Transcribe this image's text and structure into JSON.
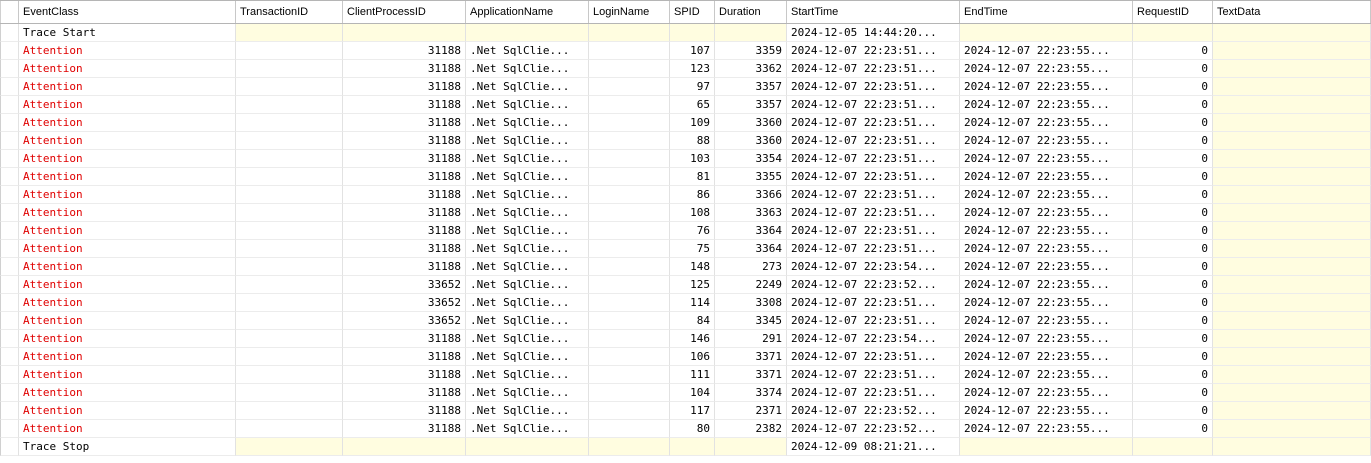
{
  "columns": [
    "EventClass",
    "TransactionID",
    "ClientProcessID",
    "ApplicationName",
    "LoginName",
    "SPID",
    "Duration",
    "StartTime",
    "EndTime",
    "RequestID",
    "TextData"
  ],
  "rows": [
    {
      "event": "Trace Start",
      "transaction": "",
      "client_pid": "",
      "app": "",
      "login": "",
      "spid": "",
      "duration": "",
      "start": "2024-12-05 14:44:20...",
      "end": "",
      "request": "",
      "text": ""
    },
    {
      "event": "Attention",
      "transaction": "",
      "client_pid": "31188",
      "app": ".Net SqlClie...",
      "login": "",
      "spid": "107",
      "duration": "3359",
      "start": "2024-12-07 22:23:51...",
      "end": "2024-12-07 22:23:55...",
      "request": "0",
      "text": ""
    },
    {
      "event": "Attention",
      "transaction": "",
      "client_pid": "31188",
      "app": ".Net SqlClie...",
      "login": "",
      "spid": "123",
      "duration": "3362",
      "start": "2024-12-07 22:23:51...",
      "end": "2024-12-07 22:23:55...",
      "request": "0",
      "text": ""
    },
    {
      "event": "Attention",
      "transaction": "",
      "client_pid": "31188",
      "app": ".Net SqlClie...",
      "login": "",
      "spid": "97",
      "duration": "3357",
      "start": "2024-12-07 22:23:51...",
      "end": "2024-12-07 22:23:55...",
      "request": "0",
      "text": ""
    },
    {
      "event": "Attention",
      "transaction": "",
      "client_pid": "31188",
      "app": ".Net SqlClie...",
      "login": "",
      "spid": "65",
      "duration": "3357",
      "start": "2024-12-07 22:23:51...",
      "end": "2024-12-07 22:23:55...",
      "request": "0",
      "text": ""
    },
    {
      "event": "Attention",
      "transaction": "",
      "client_pid": "31188",
      "app": ".Net SqlClie...",
      "login": "",
      "spid": "109",
      "duration": "3360",
      "start": "2024-12-07 22:23:51...",
      "end": "2024-12-07 22:23:55...",
      "request": "0",
      "text": ""
    },
    {
      "event": "Attention",
      "transaction": "",
      "client_pid": "31188",
      "app": ".Net SqlClie...",
      "login": "",
      "spid": "88",
      "duration": "3360",
      "start": "2024-12-07 22:23:51...",
      "end": "2024-12-07 22:23:55...",
      "request": "0",
      "text": ""
    },
    {
      "event": "Attention",
      "transaction": "",
      "client_pid": "31188",
      "app": ".Net SqlClie...",
      "login": "",
      "spid": "103",
      "duration": "3354",
      "start": "2024-12-07 22:23:51...",
      "end": "2024-12-07 22:23:55...",
      "request": "0",
      "text": ""
    },
    {
      "event": "Attention",
      "transaction": "",
      "client_pid": "31188",
      "app": ".Net SqlClie...",
      "login": "",
      "spid": "81",
      "duration": "3355",
      "start": "2024-12-07 22:23:51...",
      "end": "2024-12-07 22:23:55...",
      "request": "0",
      "text": ""
    },
    {
      "event": "Attention",
      "transaction": "",
      "client_pid": "31188",
      "app": ".Net SqlClie...",
      "login": "",
      "spid": "86",
      "duration": "3366",
      "start": "2024-12-07 22:23:51...",
      "end": "2024-12-07 22:23:55...",
      "request": "0",
      "text": ""
    },
    {
      "event": "Attention",
      "transaction": "",
      "client_pid": "31188",
      "app": ".Net SqlClie...",
      "login": "",
      "spid": "108",
      "duration": "3363",
      "start": "2024-12-07 22:23:51...",
      "end": "2024-12-07 22:23:55...",
      "request": "0",
      "text": ""
    },
    {
      "event": "Attention",
      "transaction": "",
      "client_pid": "31188",
      "app": ".Net SqlClie...",
      "login": "",
      "spid": "76",
      "duration": "3364",
      "start": "2024-12-07 22:23:51...",
      "end": "2024-12-07 22:23:55...",
      "request": "0",
      "text": ""
    },
    {
      "event": "Attention",
      "transaction": "",
      "client_pid": "31188",
      "app": ".Net SqlClie...",
      "login": "",
      "spid": "75",
      "duration": "3364",
      "start": "2024-12-07 22:23:51...",
      "end": "2024-12-07 22:23:55...",
      "request": "0",
      "text": ""
    },
    {
      "event": "Attention",
      "transaction": "",
      "client_pid": "31188",
      "app": ".Net SqlClie...",
      "login": "",
      "spid": "148",
      "duration": "273",
      "start": "2024-12-07 22:23:54...",
      "end": "2024-12-07 22:23:55...",
      "request": "0",
      "text": ""
    },
    {
      "event": "Attention",
      "transaction": "",
      "client_pid": "33652",
      "app": ".Net SqlClie...",
      "login": "",
      "spid": "125",
      "duration": "2249",
      "start": "2024-12-07 22:23:52...",
      "end": "2024-12-07 22:23:55...",
      "request": "0",
      "text": ""
    },
    {
      "event": "Attention",
      "transaction": "",
      "client_pid": "33652",
      "app": ".Net SqlClie...",
      "login": "",
      "spid": "114",
      "duration": "3308",
      "start": "2024-12-07 22:23:51...",
      "end": "2024-12-07 22:23:55...",
      "request": "0",
      "text": ""
    },
    {
      "event": "Attention",
      "transaction": "",
      "client_pid": "33652",
      "app": ".Net SqlClie...",
      "login": "",
      "spid": "84",
      "duration": "3345",
      "start": "2024-12-07 22:23:51...",
      "end": "2024-12-07 22:23:55...",
      "request": "0",
      "text": ""
    },
    {
      "event": "Attention",
      "transaction": "",
      "client_pid": "31188",
      "app": ".Net SqlClie...",
      "login": "",
      "spid": "146",
      "duration": "291",
      "start": "2024-12-07 22:23:54...",
      "end": "2024-12-07 22:23:55...",
      "request": "0",
      "text": ""
    },
    {
      "event": "Attention",
      "transaction": "",
      "client_pid": "31188",
      "app": ".Net SqlClie...",
      "login": "",
      "spid": "106",
      "duration": "3371",
      "start": "2024-12-07 22:23:51...",
      "end": "2024-12-07 22:23:55...",
      "request": "0",
      "text": ""
    },
    {
      "event": "Attention",
      "transaction": "",
      "client_pid": "31188",
      "app": ".Net SqlClie...",
      "login": "",
      "spid": "111",
      "duration": "3371",
      "start": "2024-12-07 22:23:51...",
      "end": "2024-12-07 22:23:55...",
      "request": "0",
      "text": ""
    },
    {
      "event": "Attention",
      "transaction": "",
      "client_pid": "31188",
      "app": ".Net SqlClie...",
      "login": "",
      "spid": "104",
      "duration": "3374",
      "start": "2024-12-07 22:23:51...",
      "end": "2024-12-07 22:23:55...",
      "request": "0",
      "text": ""
    },
    {
      "event": "Attention",
      "transaction": "",
      "client_pid": "31188",
      "app": ".Net SqlClie...",
      "login": "",
      "spid": "117",
      "duration": "2371",
      "start": "2024-12-07 22:23:52...",
      "end": "2024-12-07 22:23:55...",
      "request": "0",
      "text": ""
    },
    {
      "event": "Attention",
      "transaction": "",
      "client_pid": "31188",
      "app": ".Net SqlClie...",
      "login": "",
      "spid": "80",
      "duration": "2382",
      "start": "2024-12-07 22:23:52...",
      "end": "2024-12-07 22:23:55...",
      "request": "0",
      "text": ""
    },
    {
      "event": "Trace Stop",
      "transaction": "",
      "client_pid": "",
      "app": "",
      "login": "",
      "spid": "",
      "duration": "",
      "start": "2024-12-09 08:21:21...",
      "end": "",
      "request": "",
      "text": ""
    }
  ],
  "colors": {
    "attention": "#e00000",
    "normal_text": "#000000",
    "empty_cell_bg": "#fffde0",
    "grid_line": "#e2e2e2"
  }
}
